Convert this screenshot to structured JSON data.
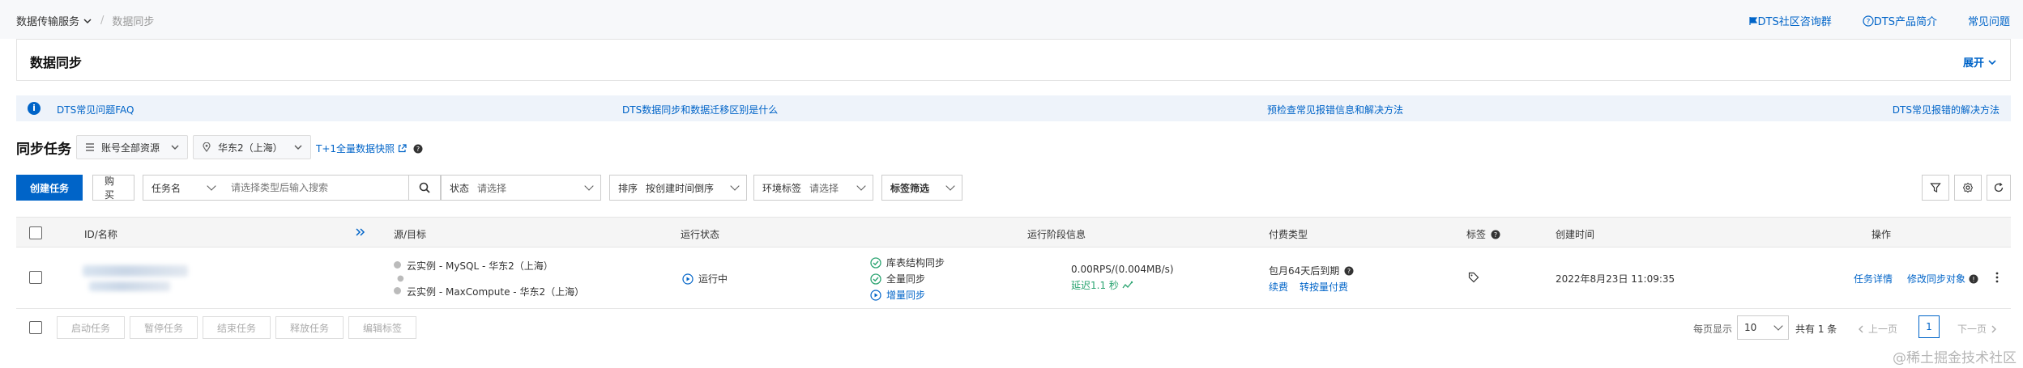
{
  "breadcrumb": {
    "service": "数据传输服务",
    "current": "数据同步"
  },
  "top_links": [
    "DTS社区咨询群",
    "DTS产品简介",
    "常见问题"
  ],
  "page_title": "数据同步",
  "expand_label": "展开",
  "faq_banner": {
    "links": [
      "DTS常见问题FAQ",
      "DTS数据同步和数据迁移区别是什么",
      "预检查常见报错信息和解决方法",
      "DTS常见报错的解决方法"
    ]
  },
  "section": {
    "title": "同步任务",
    "resource_group": "账号全部资源",
    "region": "华东2（上海）",
    "t1_link": "T+1全量数据快照"
  },
  "toolbar": {
    "create_label": "创建任务",
    "buy_label": "购买",
    "search_field": "任务名",
    "search_placeholder": "请选择类型后输入搜索",
    "status_label": "状态",
    "status_placeholder": "请选择",
    "sort_label": "排序",
    "sort_value": "按创建时间倒序",
    "env_label": "环境标签",
    "env_placeholder": "请选择",
    "tag_filter_label": "标签筛选"
  },
  "table": {
    "headers": {
      "id_name": "ID/名称",
      "src_dst": "源/目标",
      "run_status": "运行状态",
      "stage_info": "运行阶段信息",
      "billing": "付费类型",
      "tags": "标签",
      "created": "创建时间",
      "actions": "操作"
    },
    "rows": [
      {
        "source": "云实例 - MySQL - 华东2（上海）",
        "target": "云实例 - MaxCompute - 华东2（上海）",
        "status": "运行中",
        "stages": [
          "库表结构同步",
          "全量同步",
          "增量同步"
        ],
        "throughput": "0.00RPS/(0.004MB/s)",
        "latency": "延迟1.1 秒",
        "billing": "包月64天后到期",
        "renew": "续费",
        "switch_billing": "转按量付费",
        "created": "2022年8月23日 11:09:35",
        "action_detail": "任务详情",
        "action_modify": "修改同步对象"
      }
    ]
  },
  "footer": {
    "bulk_actions": [
      "启动任务",
      "暂停任务",
      "结束任务",
      "释放任务",
      "编辑标签"
    ],
    "page_size_label": "每页显示",
    "page_size": "10",
    "total": "共有 1 条",
    "prev": "上一页",
    "page": "1",
    "next": "下一页"
  },
  "watermark": "@稀土掘金技术社区",
  "colors": {
    "accent": "#0064c8",
    "success": "#2ba471",
    "banner_bg": "#eef3fa"
  }
}
